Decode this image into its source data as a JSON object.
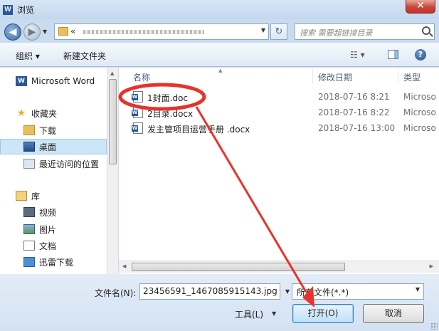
{
  "window": {
    "title": "浏览",
    "close_label": "✕"
  },
  "address": {
    "crumb": "«",
    "search_placeholder": "搜索 需要超链接目录"
  },
  "toolbar": {
    "organize_label": "组织 ▾",
    "new_folder_label": "新建文件夹",
    "view_label": "☷ ▾",
    "help_label": "?"
  },
  "sidebar": {
    "items": [
      {
        "label": "Microsoft Word",
        "icon": "word-icon"
      },
      {
        "label": "收藏夹",
        "icon": "star-icon"
      },
      {
        "label": "下载",
        "icon": "download-folder-icon"
      },
      {
        "label": "桌面",
        "icon": "desktop-icon",
        "selected": true
      },
      {
        "label": "最近访问的位置",
        "icon": "recent-places-icon"
      },
      {
        "label": "库",
        "icon": "library-icon"
      },
      {
        "label": "视频",
        "icon": "video-icon"
      },
      {
        "label": "图片",
        "icon": "pictures-icon"
      },
      {
        "label": "文档",
        "icon": "documents-icon"
      },
      {
        "label": "迅雷下载",
        "icon": "thunder-download-icon"
      }
    ]
  },
  "file_list": {
    "columns": [
      "名称",
      "修改日期",
      "类型"
    ],
    "rows": [
      {
        "name": "1封面.doc",
        "date": "2018-07-16 8:21",
        "type": "Microso"
      },
      {
        "name": "2目录.docx",
        "date": "2018-07-16 8:22",
        "type": "Microso"
      },
      {
        "name": "发主管项目运营手册 .docx",
        "date": "2018-07-16 13:00",
        "type": "Microso"
      }
    ]
  },
  "footer": {
    "filename_label": "文件名(N):",
    "filename_value": "23456591_1467085915143.jpg",
    "filetype_value": "所有文件(*.*)",
    "tools_label": "工具(L)",
    "open_label": "打开(O)",
    "cancel_label": "取消"
  },
  "colors": {
    "annotation_red": "#e8332a",
    "selection_blue": "#cde6f7"
  }
}
